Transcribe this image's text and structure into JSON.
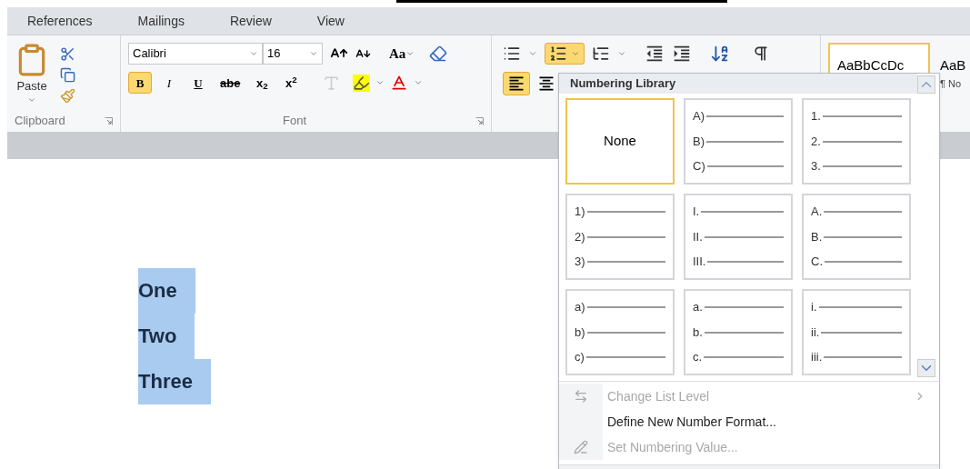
{
  "tabs": [
    {
      "label": "References",
      "selected": false
    },
    {
      "label": "Mailings",
      "selected": false
    },
    {
      "label": "Review",
      "selected": false
    },
    {
      "label": "View",
      "selected": false
    }
  ],
  "clipboard": {
    "paste_label": "Paste",
    "group_label": "Clipboard"
  },
  "font": {
    "name": "Calibri",
    "size": "16",
    "case_label": "Aa",
    "group_label": "Font",
    "buttons": [
      {
        "label": "B",
        "kind": "bold",
        "selected": true
      },
      {
        "label": "I",
        "kind": "italic",
        "selected": false
      },
      {
        "label": "U",
        "kind": "underline",
        "selected": false
      },
      {
        "label": "abe",
        "kind": "strike",
        "selected": false
      },
      {
        "label": "x$_{2}$",
        "kind": "script",
        "selected": false
      },
      {
        "label": "x$^{2}$",
        "kind": "script",
        "selected": false
      }
    ]
  },
  "paragraph": {
    "numbering_selected": true,
    "align_left_selected": true
  },
  "styles": [
    {
      "sample": "AaBbCcDc",
      "selected": true
    },
    {
      "sample": "AaB",
      "name": "¶ No",
      "selected": false
    }
  ],
  "document": {
    "lines": [
      "One",
      "Two",
      "Three"
    ]
  },
  "numbering_menu": {
    "title": "Numbering Library",
    "formats": [
      {
        "kind": "none",
        "label": "None",
        "selected": true
      },
      {
        "kind": "list",
        "markers": [
          "A)",
          "B)",
          "C)"
        ],
        "selected": false
      },
      {
        "kind": "list",
        "markers": [
          "1.",
          "2.",
          "3."
        ],
        "selected": false
      },
      {
        "kind": "list",
        "markers": [
          "1)",
          "2)",
          "3)"
        ],
        "selected": false
      },
      {
        "kind": "list",
        "markers": [
          "I.",
          "II.",
          "III."
        ],
        "selected": false
      },
      {
        "kind": "list",
        "markers": [
          "A.",
          "B.",
          "C."
        ],
        "selected": false
      },
      {
        "kind": "list",
        "markers": [
          "a)",
          "b)",
          "c)"
        ],
        "selected": false
      },
      {
        "kind": "list",
        "markers": [
          "a.",
          "b.",
          "c."
        ],
        "selected": false
      },
      {
        "kind": "list",
        "markers": [
          "i.",
          "ii.",
          "iii."
        ],
        "selected": false
      }
    ],
    "commands": [
      {
        "label": "Change List Level",
        "kind": "level",
        "disabled": true,
        "submenu": true
      },
      {
        "label": "Define New Number Format...",
        "kind": "define",
        "disabled": false,
        "submenu": false
      },
      {
        "label": "Set Numbering Value...",
        "kind": "value",
        "disabled": true,
        "submenu": false
      }
    ]
  }
}
